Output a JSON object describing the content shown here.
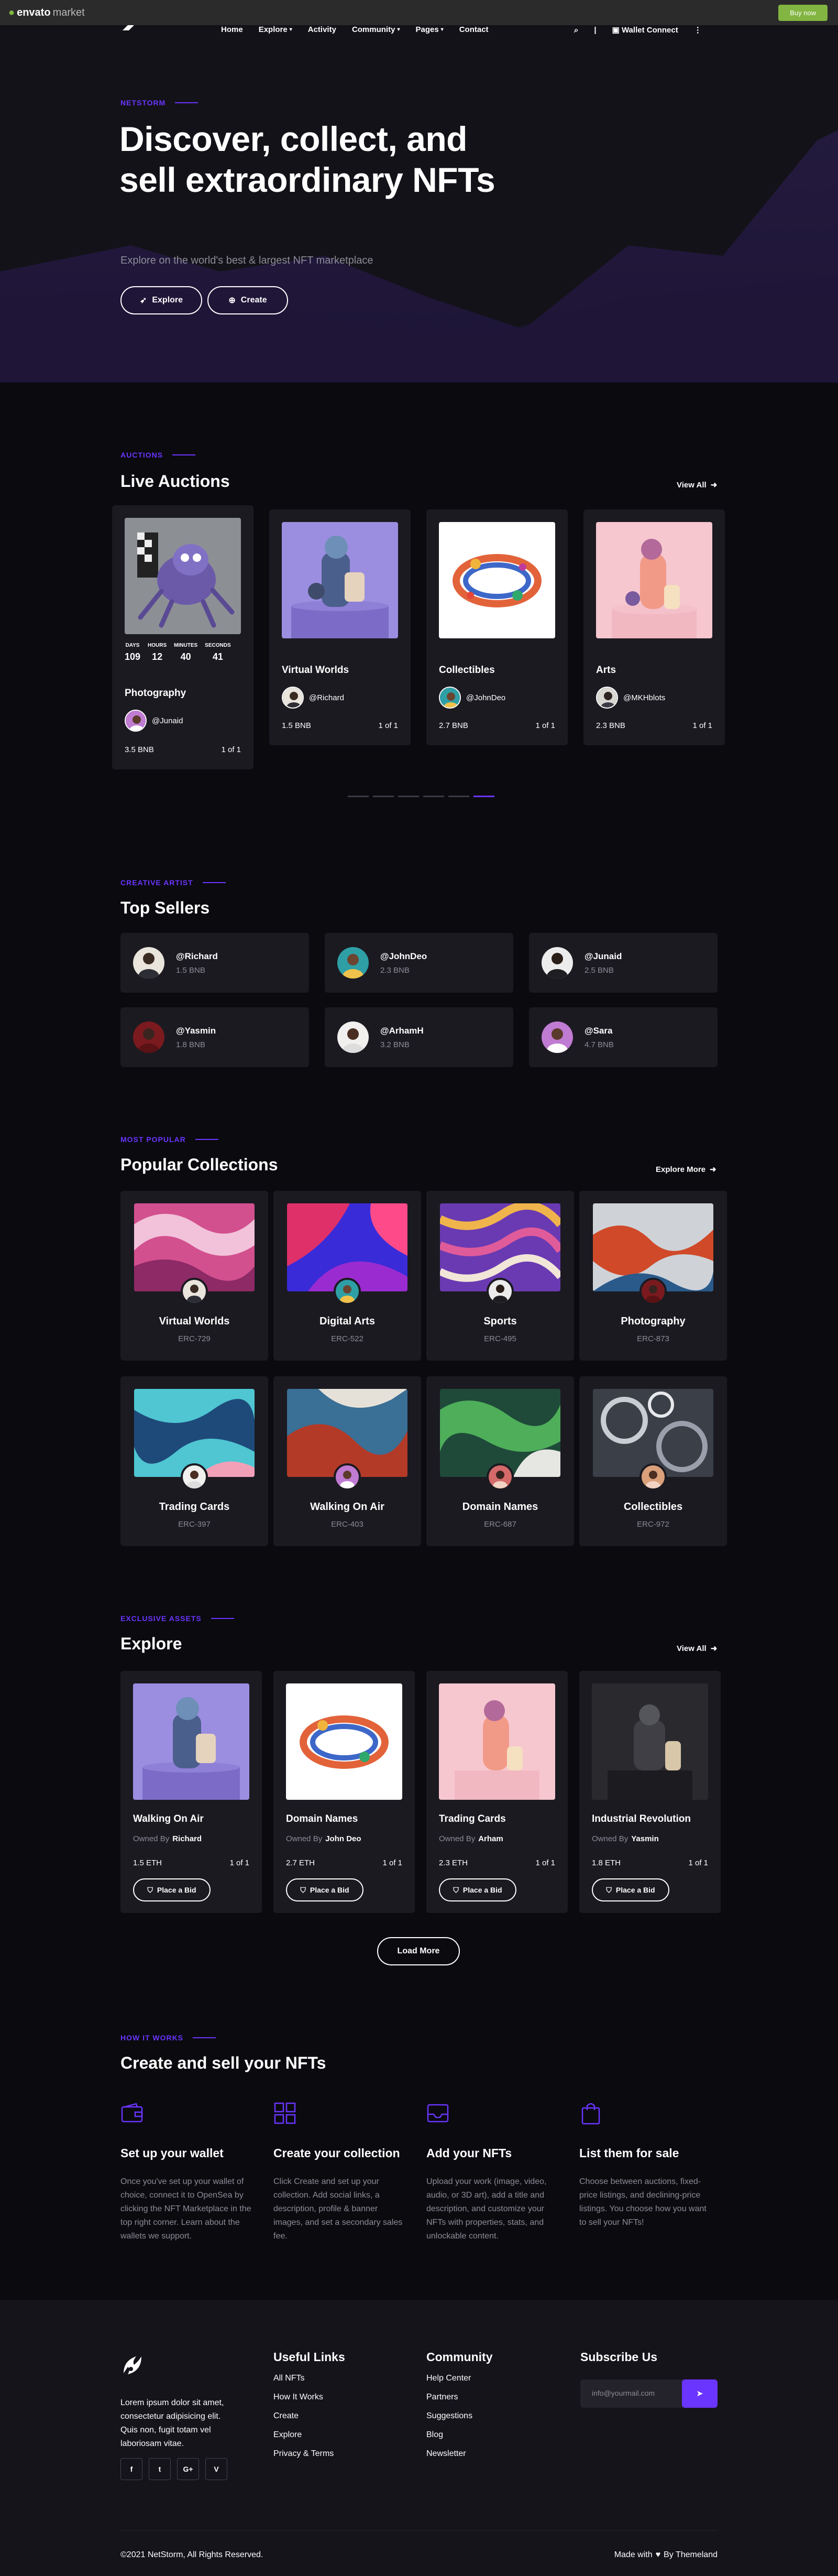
{
  "envato": {
    "logo_text": "envato",
    "logo_suffix": "market",
    "buy_label": "Buy now"
  },
  "nav": {
    "items": [
      "Home",
      "Explore",
      "Activity",
      "Community",
      "Pages",
      "Contact"
    ],
    "wallet_label": "Wallet Connect"
  },
  "hero": {
    "tag": "NETSTORM",
    "title": "Discover, collect, and sell extraordinary NFTs",
    "subtitle": "Explore on the world's best & largest NFT marketplace",
    "explore_label": "Explore",
    "create_label": "Create"
  },
  "auctions": {
    "tag": "AUCTIONS",
    "title": "Live Auctions",
    "view_all": "View All",
    "countdown": {
      "labels": [
        "DAYS",
        "HOURS",
        "MINUTES",
        "SECONDS"
      ],
      "values": [
        "109",
        "12",
        "40",
        "41"
      ]
    },
    "items": [
      {
        "title": "Photography",
        "owner": "@Junaid",
        "price": "3.5 BNB",
        "edition": "1 of 1"
      },
      {
        "title": "Virtual Worlds",
        "owner": "@Richard",
        "price": "1.5 BNB",
        "edition": "1 of 1"
      },
      {
        "title": "Collectibles",
        "owner": "@JohnDeo",
        "price": "2.7 BNB",
        "edition": "1 of 1"
      },
      {
        "title": "Arts",
        "owner": "@MKHblots",
        "price": "2.3 BNB",
        "edition": "1 of 1"
      }
    ]
  },
  "sellers": {
    "tag": "CREATIVE ARTIST",
    "title": "Top Sellers",
    "items": [
      {
        "name": "@Richard",
        "price": "1.5 BNB"
      },
      {
        "name": "@JohnDeo",
        "price": "2.3 BNB"
      },
      {
        "name": "@Junaid",
        "price": "2.5 BNB"
      },
      {
        "name": "@Yasmin",
        "price": "1.8 BNB"
      },
      {
        "name": "@ArhamH",
        "price": "3.2 BNB"
      },
      {
        "name": "@Sara",
        "price": "4.7 BNB"
      }
    ]
  },
  "collections": {
    "tag": "MOST POPULAR",
    "title": "Popular Collections",
    "explore_more": "Explore More",
    "items": [
      {
        "title": "Virtual Worlds",
        "code": "ERC-729"
      },
      {
        "title": "Digital Arts",
        "code": "ERC-522"
      },
      {
        "title": "Sports",
        "code": "ERC-495"
      },
      {
        "title": "Photography",
        "code": "ERC-873"
      },
      {
        "title": "Trading Cards",
        "code": "ERC-397"
      },
      {
        "title": "Walking On Air",
        "code": "ERC-403"
      },
      {
        "title": "Domain Names",
        "code": "ERC-687"
      },
      {
        "title": "Collectibles",
        "code": "ERC-972"
      }
    ]
  },
  "explore": {
    "tag": "EXCLUSIVE ASSETS",
    "title": "Explore",
    "view_all": "View All",
    "owned_label": "Owned By",
    "bid_label": "Place a Bid",
    "load_more": "Load More",
    "items": [
      {
        "title": "Walking On Air",
        "owner": "Richard",
        "price": "1.5 ETH",
        "edition": "1 of 1"
      },
      {
        "title": "Domain Names",
        "owner": "John Deo",
        "price": "2.7 ETH",
        "edition": "1 of 1"
      },
      {
        "title": "Trading Cards",
        "owner": "Arham",
        "price": "2.3 ETH",
        "edition": "1 of 1"
      },
      {
        "title": "Industrial Revolution",
        "owner": "Yasmin",
        "price": "1.8 ETH",
        "edition": "1 of 1"
      }
    ]
  },
  "how": {
    "tag": "HOW IT WORKS",
    "title": "Create and sell your NFTs",
    "steps": [
      {
        "icon": "wallet-icon",
        "title": "Set up your wallet",
        "text": "Once you've set up your wallet of choice, connect it to OpenSea by clicking the NFT Marketplace in the top right corner. Learn about the wallets we support."
      },
      {
        "icon": "grid-icon",
        "title": "Create your collection",
        "text": "Click Create and set up your collection. Add social links, a description, profile & banner images, and set a secondary sales fee."
      },
      {
        "icon": "inbox-icon",
        "title": "Add your NFTs",
        "text": "Upload your work (image, video, audio, or 3D art), add a title and description, and customize your NFTs with properties, stats, and unlockable content."
      },
      {
        "icon": "bag-icon",
        "title": "List them for sale",
        "text": "Choose between auctions, fixed-price listings, and declining-price listings. You choose how you want to sell your NFTs!"
      }
    ]
  },
  "footer": {
    "about": "Lorem ipsum dolor sit amet, consectetur adipisicing elit. Quis non, fugit totam vel laboriosam vitae.",
    "socials": [
      "f",
      "t",
      "G+",
      "V"
    ],
    "useful_title": "Useful Links",
    "useful": [
      "All NFTs",
      "How It Works",
      "Create",
      "Explore",
      "Privacy & Terms"
    ],
    "community_title": "Community",
    "community": [
      "Help Center",
      "Partners",
      "Suggestions",
      "Blog",
      "Newsletter"
    ],
    "subscribe_title": "Subscribe Us",
    "email_placeholder": "info@yourmail.com",
    "copyright": "©2021 NetStorm, All Rights Reserved.",
    "made_prefix": "Made with",
    "made_suffix": "By Themeland"
  },
  "colors": {
    "accent": "#6a35ff",
    "card": "#1b1a21",
    "bg": "#0b0a0f",
    "envato_green": "#82b541"
  }
}
